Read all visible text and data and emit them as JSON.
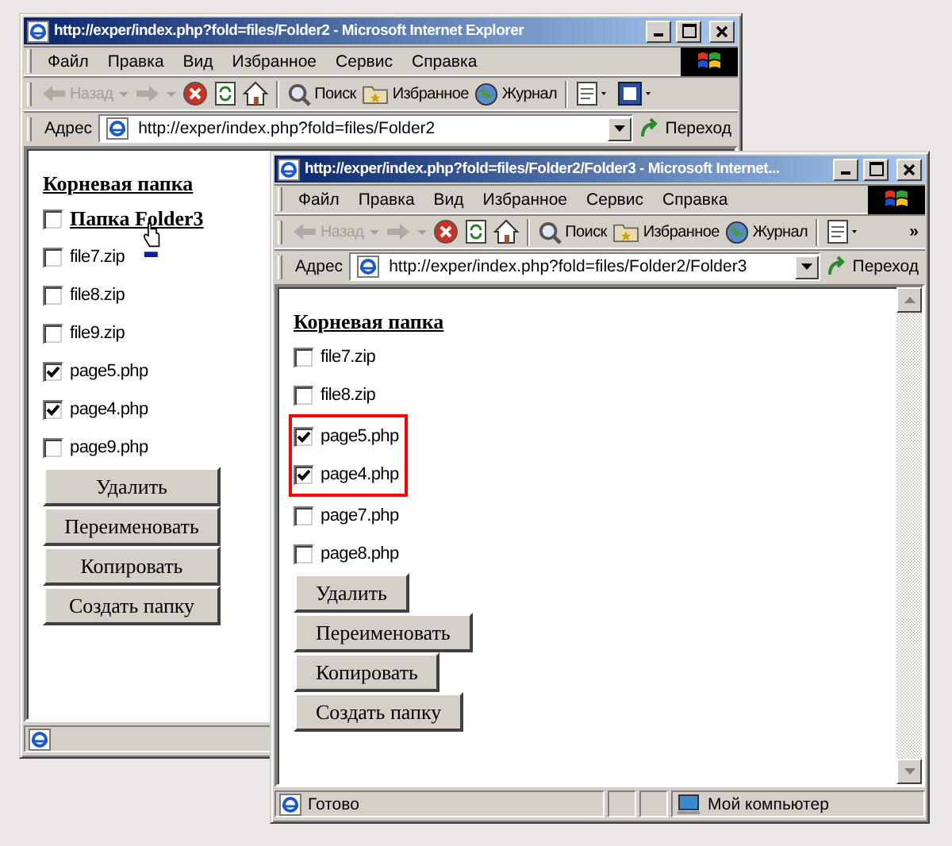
{
  "windows": [
    {
      "title": "http://exper/index.php?fold=files/Folder2 - Microsoft Internet Explorer",
      "menu": [
        "Файл",
        "Правка",
        "Вид",
        "Избранное",
        "Сервис",
        "Справка"
      ],
      "toolbar": [
        {
          "kind": "back",
          "label": "Назад",
          "disabled": true
        },
        {
          "kind": "forward",
          "disabled": true
        },
        {
          "kind": "stop",
          "disabled": false
        },
        {
          "kind": "refresh",
          "disabled": false
        },
        {
          "kind": "home",
          "disabled": false
        },
        {
          "kind": "search",
          "label": "Поиск",
          "disabled": false
        },
        {
          "kind": "favorites",
          "label": "Избранное",
          "disabled": false
        },
        {
          "kind": "history",
          "label": "Журнал",
          "disabled": false
        },
        {
          "kind": "mail",
          "disabled": false
        },
        {
          "kind": "edit",
          "disabled": false
        }
      ],
      "address": {
        "label": "Адрес",
        "value": "http://exper/index.php?fold=files/Folder2",
        "go": "Переход"
      },
      "content": {
        "heading": "Корневая папка",
        "buttons_equal_width": true,
        "items": [
          {
            "kind": "folder",
            "label": "Папка Folder3",
            "checked": false,
            "highlighted": false
          },
          {
            "kind": "file",
            "label": "file7.zip",
            "checked": false,
            "highlighted": false
          },
          {
            "kind": "file",
            "label": "file8.zip",
            "checked": false,
            "highlighted": false
          },
          {
            "kind": "file",
            "label": "file9.zip",
            "checked": false,
            "highlighted": false
          },
          {
            "kind": "file",
            "label": "page5.php",
            "checked": true,
            "highlighted": false
          },
          {
            "kind": "file",
            "label": "page4.php",
            "checked": true,
            "highlighted": false
          },
          {
            "kind": "file",
            "label": "page9.php",
            "checked": false,
            "highlighted": false
          }
        ],
        "buttons": [
          "Удалить",
          "Переименовать",
          "Копировать",
          "Создать папку"
        ],
        "scrollbar": false
      }
    },
    {
      "title": "http://exper/index.php?fold=files/Folder2/Folder3 - Microsoft Internet...",
      "menu": [
        "Файл",
        "Правка",
        "Вид",
        "Избранное",
        "Сервис",
        "Справка"
      ],
      "toolbar": [
        {
          "kind": "back",
          "label": "Назад",
          "disabled": true
        },
        {
          "kind": "forward",
          "disabled": true
        },
        {
          "kind": "stop",
          "disabled": false
        },
        {
          "kind": "refresh",
          "disabled": false
        },
        {
          "kind": "home",
          "disabled": false
        },
        {
          "kind": "search",
          "label": "Поиск",
          "disabled": false
        },
        {
          "kind": "favorites",
          "label": "Избранное",
          "disabled": false
        },
        {
          "kind": "history",
          "label": "Журнал",
          "disabled": false
        },
        {
          "kind": "mail",
          "disabled": false
        }
      ],
      "toolbar_overflow": "»",
      "address": {
        "label": "Адрес",
        "value": "http://exper/index.php?fold=files/Folder2/Folder3",
        "go": "Переход"
      },
      "content": {
        "heading": "Корневая папка",
        "buttons_equal_width": false,
        "items": [
          {
            "kind": "file",
            "label": "file7.zip",
            "checked": false,
            "highlighted": false
          },
          {
            "kind": "file",
            "label": "file8.zip",
            "checked": false,
            "highlighted": false
          },
          {
            "kind": "file",
            "label": "page5.php",
            "checked": true,
            "highlighted": true
          },
          {
            "kind": "file",
            "label": "page4.php",
            "checked": true,
            "highlighted": true
          },
          {
            "kind": "file",
            "label": "page7.php",
            "checked": false,
            "highlighted": false
          },
          {
            "kind": "file",
            "label": "page8.php",
            "checked": false,
            "highlighted": false
          }
        ],
        "buttons": [
          "Удалить",
          "Переименовать",
          "Копировать",
          "Создать папку"
        ],
        "scrollbar": true
      },
      "status_bar": {
        "text": "Готово",
        "zone": "Мой компьютер"
      }
    }
  ]
}
